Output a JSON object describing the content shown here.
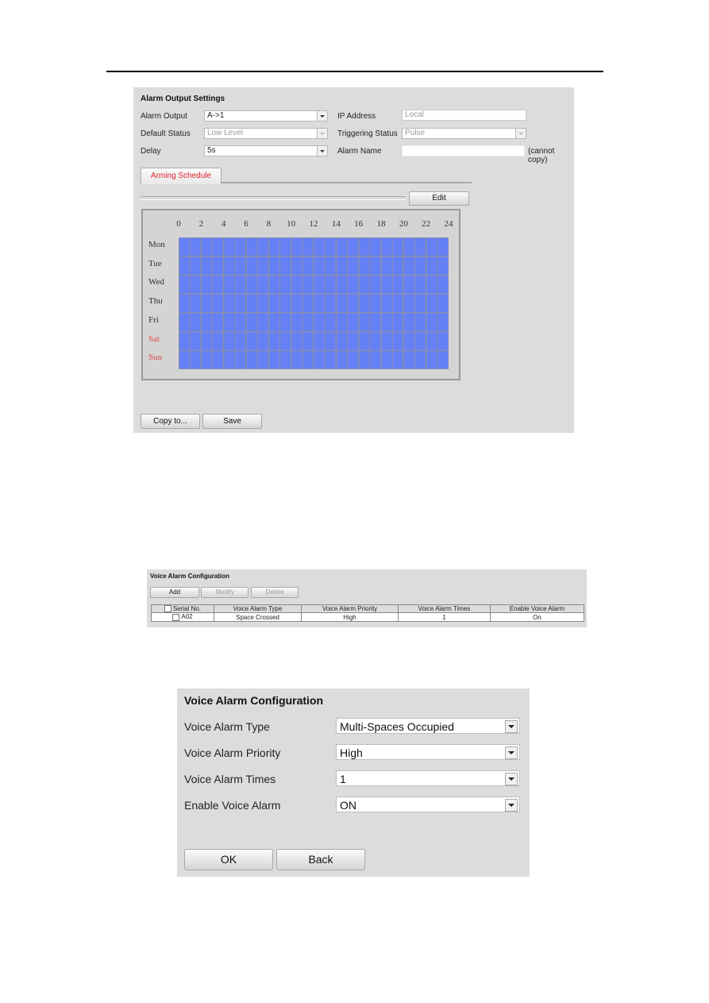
{
  "alarm_output_settings": {
    "title": "Alarm Output Settings",
    "fields": {
      "alarm_output": {
        "label": "Alarm Output",
        "value": "A->1"
      },
      "ip_address": {
        "label": "IP Address",
        "value": "Local"
      },
      "default_status": {
        "label": "Default Status",
        "value": "Low Level"
      },
      "triggering_status": {
        "label": "Triggering Status",
        "value": "Pulse"
      },
      "delay": {
        "label": "Delay",
        "value": "5s"
      },
      "alarm_name": {
        "label": "Alarm Name",
        "value": "",
        "note": "(cannot copy)"
      }
    },
    "tab_label": "Arming Schedule",
    "edit_label": "Edit",
    "schedule": {
      "hours": [
        "0",
        "2",
        "4",
        "6",
        "8",
        "10",
        "12",
        "14",
        "16",
        "18",
        "20",
        "22",
        "24"
      ],
      "days": [
        {
          "label": "Mon",
          "weekend": false,
          "armed_hours": [
            0,
            24
          ]
        },
        {
          "label": "Tue",
          "weekend": false,
          "armed_hours": [
            0,
            24
          ]
        },
        {
          "label": "Wed",
          "weekend": false,
          "armed_hours": [
            0,
            24
          ]
        },
        {
          "label": "Thu",
          "weekend": false,
          "armed_hours": [
            0,
            24
          ]
        },
        {
          "label": "Fri",
          "weekend": false,
          "armed_hours": [
            0,
            24
          ]
        },
        {
          "label": "Sat",
          "weekend": true,
          "armed_hours": [
            0,
            24
          ]
        },
        {
          "label": "Sun",
          "weekend": true,
          "armed_hours": [
            0,
            24
          ]
        }
      ],
      "armed_color": "#6680f5",
      "weekend_color": "#e04a4a"
    },
    "buttons": {
      "copy_to": "Copy to...",
      "save": "Save"
    }
  },
  "voice_alarm_list": {
    "title": "Voice Alarm Configuration",
    "buttons": {
      "add": "Add",
      "modify": "Modify",
      "delete": "Delete"
    },
    "columns": [
      "Serial No.",
      "Voice Alarm Type",
      "Voice Alarm Priority",
      "Voice Alarm Times",
      "Enable Voice Alarm"
    ],
    "rows": [
      {
        "serial": "A02",
        "type": "Space Crossed",
        "priority": "High",
        "times": "1",
        "enabled": "On"
      }
    ]
  },
  "voice_alarm_form": {
    "title": "Voice Alarm Configuration",
    "fields": [
      {
        "label": "Voice Alarm Type",
        "value": "Multi-Spaces Occupied"
      },
      {
        "label": "Voice Alarm Priority",
        "value": "High"
      },
      {
        "label": "Voice Alarm Times",
        "value": "1"
      },
      {
        "label": "Enable Voice Alarm",
        "value": "ON"
      }
    ],
    "buttons": {
      "ok": "OK",
      "back": "Back"
    }
  }
}
